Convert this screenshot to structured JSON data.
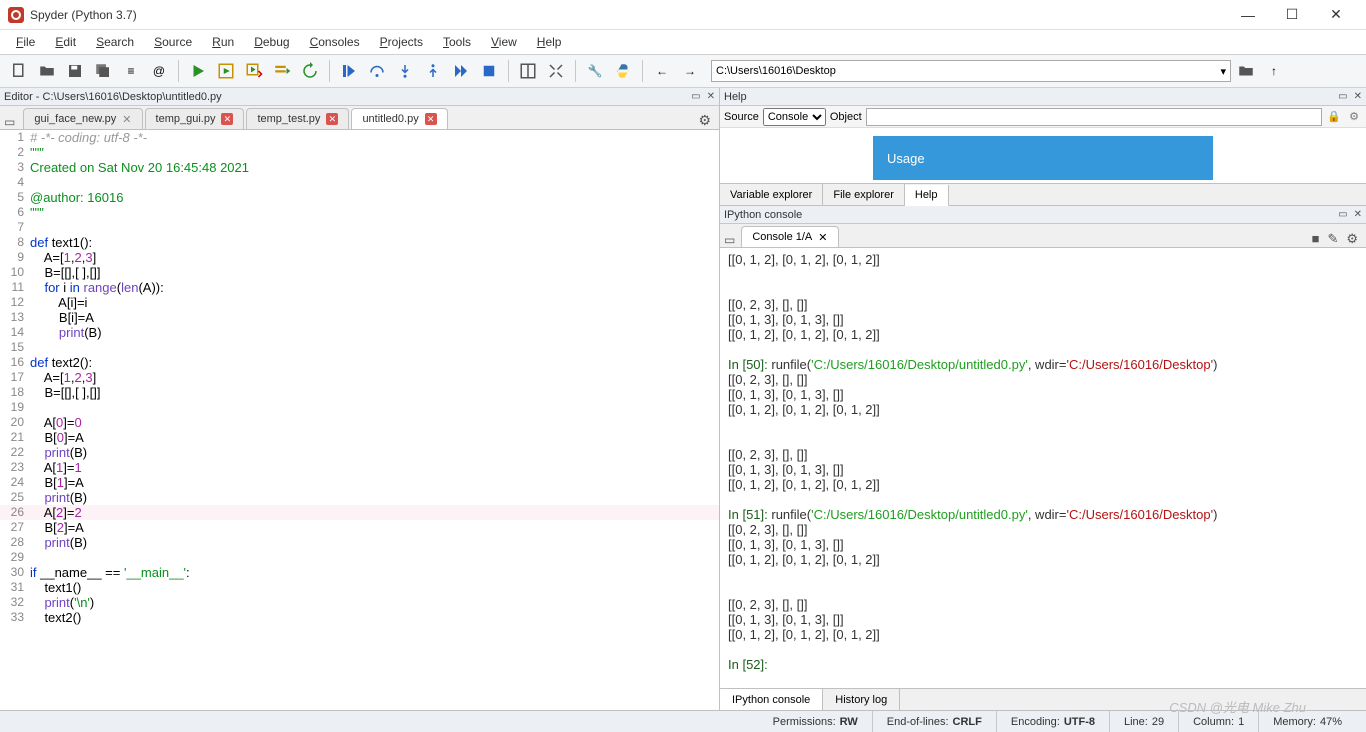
{
  "window": {
    "title": "Spyder (Python 3.7)"
  },
  "menu": [
    "File",
    "Edit",
    "Search",
    "Source",
    "Run",
    "Debug",
    "Consoles",
    "Projects",
    "Tools",
    "View",
    "Help"
  ],
  "toolbar": {
    "path": "C:\\Users\\16016\\Desktop",
    "icons": [
      "new-file",
      "open-file",
      "save",
      "save-all",
      "list",
      "at",
      "run",
      "run-cell",
      "run-cell-advance",
      "run-selection",
      "rerun",
      "debug-start",
      "step-over",
      "step-into",
      "step-out",
      "continue",
      "stop-debug",
      "layout",
      "maximize",
      "wrench",
      "python",
      "back",
      "forward"
    ]
  },
  "editor": {
    "header": "Editor - C:\\Users\\16016\\Desktop\\untitled0.py",
    "tabs": [
      {
        "name": "gui_face_new.py",
        "dirty": false,
        "active": false
      },
      {
        "name": "temp_gui.py",
        "dirty": true,
        "active": false
      },
      {
        "name": "temp_test.py",
        "dirty": true,
        "active": false
      },
      {
        "name": "untitled0.py",
        "dirty": true,
        "active": true
      }
    ],
    "code": {
      "lines": [
        {
          "n": 1,
          "seg": [
            {
              "cls": "c-comment",
              "t": "# -*- coding: utf-8 -*-"
            }
          ]
        },
        {
          "n": 2,
          "seg": [
            {
              "cls": "c-str",
              "t": "\"\"\""
            }
          ]
        },
        {
          "n": 3,
          "seg": [
            {
              "cls": "c-str",
              "t": "Created on Sat Nov 20 16:45:48 2021"
            }
          ]
        },
        {
          "n": 4,
          "seg": [
            {
              "cls": "",
              "t": ""
            }
          ]
        },
        {
          "n": 5,
          "seg": [
            {
              "cls": "c-str",
              "t": "@author: 16016"
            }
          ]
        },
        {
          "n": 6,
          "seg": [
            {
              "cls": "c-str",
              "t": "\"\"\""
            }
          ]
        },
        {
          "n": 7,
          "seg": [
            {
              "cls": "",
              "t": ""
            }
          ]
        },
        {
          "n": 8,
          "seg": [
            {
              "cls": "c-kw",
              "t": "def "
            },
            {
              "cls": "c-name",
              "t": "text1():"
            }
          ]
        },
        {
          "n": 9,
          "seg": [
            {
              "cls": "",
              "t": "    A=["
            },
            {
              "cls": "c-num",
              "t": "1"
            },
            {
              "cls": "",
              "t": ","
            },
            {
              "cls": "c-num",
              "t": "2"
            },
            {
              "cls": "",
              "t": ","
            },
            {
              "cls": "c-num",
              "t": "3"
            },
            {
              "cls": "",
              "t": "]"
            }
          ]
        },
        {
          "n": 10,
          "seg": [
            {
              "cls": "",
              "t": "    B=[[],[ ],[]]"
            }
          ]
        },
        {
          "n": 11,
          "seg": [
            {
              "cls": "",
              "t": "    "
            },
            {
              "cls": "c-kw",
              "t": "for"
            },
            {
              "cls": "",
              "t": " i "
            },
            {
              "cls": "c-kw",
              "t": "in"
            },
            {
              "cls": "",
              "t": " "
            },
            {
              "cls": "c-builtin",
              "t": "range"
            },
            {
              "cls": "",
              "t": "("
            },
            {
              "cls": "c-builtin",
              "t": "len"
            },
            {
              "cls": "",
              "t": "(A)):"
            }
          ]
        },
        {
          "n": 12,
          "seg": [
            {
              "cls": "",
              "t": "        A[i]=i"
            }
          ]
        },
        {
          "n": 13,
          "seg": [
            {
              "cls": "",
              "t": "        B[i]=A"
            }
          ]
        },
        {
          "n": 14,
          "seg": [
            {
              "cls": "",
              "t": "        "
            },
            {
              "cls": "c-builtin",
              "t": "print"
            },
            {
              "cls": "",
              "t": "(B)"
            }
          ]
        },
        {
          "n": 15,
          "seg": [
            {
              "cls": "",
              "t": ""
            }
          ]
        },
        {
          "n": 16,
          "seg": [
            {
              "cls": "c-kw",
              "t": "def "
            },
            {
              "cls": "c-name",
              "t": "text2():"
            }
          ]
        },
        {
          "n": 17,
          "seg": [
            {
              "cls": "",
              "t": "    A=["
            },
            {
              "cls": "c-num",
              "t": "1"
            },
            {
              "cls": "",
              "t": ","
            },
            {
              "cls": "c-num",
              "t": "2"
            },
            {
              "cls": "",
              "t": ","
            },
            {
              "cls": "c-num",
              "t": "3"
            },
            {
              "cls": "",
              "t": "]"
            }
          ]
        },
        {
          "n": 18,
          "seg": [
            {
              "cls": "",
              "t": "    B=[[],[ ],[]]"
            }
          ]
        },
        {
          "n": 19,
          "seg": [
            {
              "cls": "",
              "t": ""
            }
          ]
        },
        {
          "n": 20,
          "seg": [
            {
              "cls": "",
              "t": "    A["
            },
            {
              "cls": "c-num",
              "t": "0"
            },
            {
              "cls": "",
              "t": "]="
            },
            {
              "cls": "c-num",
              "t": "0"
            }
          ]
        },
        {
          "n": 21,
          "seg": [
            {
              "cls": "",
              "t": "    B["
            },
            {
              "cls": "c-num",
              "t": "0"
            },
            {
              "cls": "",
              "t": "]=A"
            }
          ]
        },
        {
          "n": 22,
          "seg": [
            {
              "cls": "",
              "t": "    "
            },
            {
              "cls": "c-builtin",
              "t": "print"
            },
            {
              "cls": "",
              "t": "(B)"
            }
          ]
        },
        {
          "n": 23,
          "seg": [
            {
              "cls": "",
              "t": "    A["
            },
            {
              "cls": "c-num",
              "t": "1"
            },
            {
              "cls": "",
              "t": "]="
            },
            {
              "cls": "c-num",
              "t": "1"
            }
          ]
        },
        {
          "n": 24,
          "seg": [
            {
              "cls": "",
              "t": "    B["
            },
            {
              "cls": "c-num",
              "t": "1"
            },
            {
              "cls": "",
              "t": "]=A"
            }
          ]
        },
        {
          "n": 25,
          "seg": [
            {
              "cls": "",
              "t": "    "
            },
            {
              "cls": "c-builtin",
              "t": "print"
            },
            {
              "cls": "",
              "t": "(B)"
            }
          ]
        },
        {
          "n": 26,
          "hl": true,
          "seg": [
            {
              "cls": "",
              "t": "    A["
            },
            {
              "cls": "c-num",
              "t": "2"
            },
            {
              "cls": "",
              "t": "]="
            },
            {
              "cls": "c-num",
              "t": "2"
            }
          ]
        },
        {
          "n": 27,
          "seg": [
            {
              "cls": "",
              "t": "    B["
            },
            {
              "cls": "c-num",
              "t": "2"
            },
            {
              "cls": "",
              "t": "]=A"
            }
          ]
        },
        {
          "n": 28,
          "seg": [
            {
              "cls": "",
              "t": "    "
            },
            {
              "cls": "c-builtin",
              "t": "print"
            },
            {
              "cls": "",
              "t": "(B)"
            }
          ]
        },
        {
          "n": 29,
          "seg": [
            {
              "cls": "",
              "t": ""
            }
          ]
        },
        {
          "n": 30,
          "seg": [
            {
              "cls": "c-kw",
              "t": "if"
            },
            {
              "cls": "",
              "t": " __name__ == "
            },
            {
              "cls": "c-str",
              "t": "'__main__'"
            },
            {
              "cls": "",
              "t": ":"
            }
          ]
        },
        {
          "n": 31,
          "seg": [
            {
              "cls": "",
              "t": "    text1()"
            }
          ]
        },
        {
          "n": 32,
          "seg": [
            {
              "cls": "",
              "t": "    "
            },
            {
              "cls": "c-builtin",
              "t": "print"
            },
            {
              "cls": "",
              "t": "("
            },
            {
              "cls": "c-str",
              "t": "'\\n'"
            },
            {
              "cls": "",
              "t": ")"
            }
          ]
        },
        {
          "n": 33,
          "seg": [
            {
              "cls": "",
              "t": "    text2()"
            }
          ]
        }
      ]
    }
  },
  "help": {
    "header": "Help",
    "source_label": "Source",
    "source_value": "Console",
    "object_label": "Object",
    "object_value": "",
    "usage": "Usage",
    "bottom_tabs": [
      "Variable explorer",
      "File explorer",
      "Help"
    ],
    "active_tab": 2
  },
  "console": {
    "header": "IPython console",
    "tab": "Console 1/A",
    "bottom_tabs": [
      "IPython console",
      "History log"
    ],
    "output_lines": [
      {
        "t": "[[0, 1, 2], [0, 1, 2], [0, 1, 2]]"
      },
      {
        "t": ""
      },
      {
        "t": ""
      },
      {
        "t": "[[0, 2, 3], [], []]"
      },
      {
        "t": "[[0, 1, 3], [0, 1, 3], []]"
      },
      {
        "t": "[[0, 1, 2], [0, 1, 2], [0, 1, 2]]"
      },
      {
        "t": ""
      },
      {
        "in": "In [50]: ",
        "run": "runfile(",
        "p": "'C:/Users/16016/Desktop/untitled0.py'",
        "mid": ", wdir=",
        "w": "'C:/Users/16016/Desktop'",
        "end": ")"
      },
      {
        "t": "[[0, 2, 3], [], []]"
      },
      {
        "t": "[[0, 1, 3], [0, 1, 3], []]"
      },
      {
        "t": "[[0, 1, 2], [0, 1, 2], [0, 1, 2]]"
      },
      {
        "t": ""
      },
      {
        "t": ""
      },
      {
        "t": "[[0, 2, 3], [], []]"
      },
      {
        "t": "[[0, 1, 3], [0, 1, 3], []]"
      },
      {
        "t": "[[0, 1, 2], [0, 1, 2], [0, 1, 2]]"
      },
      {
        "t": ""
      },
      {
        "in": "In [51]: ",
        "run": "runfile(",
        "p": "'C:/Users/16016/Desktop/untitled0.py'",
        "mid": ", wdir=",
        "w": "'C:/Users/16016/Desktop'",
        "end": ")"
      },
      {
        "t": "[[0, 2, 3], [], []]"
      },
      {
        "t": "[[0, 1, 3], [0, 1, 3], []]"
      },
      {
        "t": "[[0, 1, 2], [0, 1, 2], [0, 1, 2]]"
      },
      {
        "t": ""
      },
      {
        "t": ""
      },
      {
        "t": "[[0, 2, 3], [], []]"
      },
      {
        "t": "[[0, 1, 3], [0, 1, 3], []]"
      },
      {
        "t": "[[0, 1, 2], [0, 1, 2], [0, 1, 2]]"
      },
      {
        "t": ""
      },
      {
        "in": "In [52]: "
      }
    ]
  },
  "status": {
    "permissions_label": "Permissions:",
    "permissions": "RW",
    "eol_label": "End-of-lines:",
    "eol": "CRLF",
    "enc_label": "Encoding:",
    "enc": "UTF-8",
    "line_label": "Line:",
    "line": "29",
    "col_label": "Column:",
    "col": "1",
    "mem_label": "Memory:",
    "mem": "47%"
  },
  "watermark": "CSDN @光电 Mike Zhu"
}
